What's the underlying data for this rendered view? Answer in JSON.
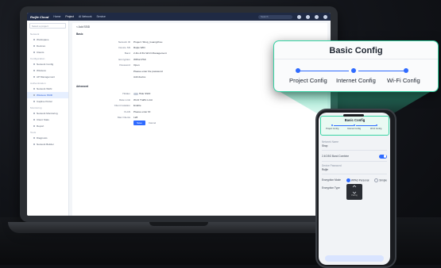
{
  "app": {
    "brand": "Ruijie Cloud",
    "nav": [
      "Home",
      "Project",
      "AI Network",
      "Service"
    ],
    "search_placeholder": "Search"
  },
  "sidebar": {
    "project_select": "Select a project",
    "groups": [
      {
        "label": "Network",
        "items": [
          "Workspace",
          "Devices",
          "Clients"
        ]
      },
      {
        "label": "Configuration",
        "items": [
          "Network Config",
          "Wireless",
          "AP Management"
        ]
      },
      {
        "label": "Authentication",
        "items": [
          "Network WAN",
          "Wireless SSID",
          "Captive Portal"
        ]
      },
      {
        "label": "Monitoring",
        "items": [
          "Network Monitoring",
          "Client Stats",
          "Report"
        ]
      },
      {
        "label": "Tools",
        "items": [
          "Diagnosis",
          "Network Builder"
        ]
      }
    ],
    "active_item": "Wireless SSID"
  },
  "main": {
    "breadcrumb": "< Add SSID",
    "section_basic": "Basic",
    "section_advanced": "Advanced",
    "fields": [
      {
        "label": "Network ID",
        "value": "Project: Shop_Guangzhou"
      },
      {
        "label": "Device SN",
        "value": "Ruijie WiFi"
      },
      {
        "label": "Band",
        "value": "2.4G & 5G     Wi-Fi Management"
      },
      {
        "label": "Encryption",
        "value": "WPA2-PSK"
      },
      {
        "label": "Password",
        "value": "Open"
      },
      {
        "label": "",
        "value": "Please enter the password"
      },
      {
        "label": "",
        "value": "Add device"
      }
    ],
    "advanced_fields": [
      {
        "label": "Hidden",
        "value": "Hide SSID"
      },
      {
        "label": "Rate Limit",
        "value": "Wi-Fi Traffic Limit"
      },
      {
        "label": "Client Isolation",
        "value": "Enable"
      },
      {
        "label": "VLAN",
        "value": "Please enter ID"
      },
      {
        "label": "Max Clients",
        "value": "128"
      }
    ],
    "save_label": "Save",
    "cancel_label": "Cancel"
  },
  "callout": {
    "title": "Basic Config",
    "steps": [
      "Project Config",
      "Internet Config",
      "Wi-Fi Config"
    ],
    "accent": "#37d3a4",
    "step_color": "#2f6bff"
  },
  "phone": {
    "title": "Basic Config",
    "steps": [
      "Project Config",
      "Internet Config",
      "Wi-Fi Config"
    ],
    "fields": [
      {
        "label": "Network Name",
        "value": "Shop"
      },
      {
        "label": "2.4G/5G Band Combine",
        "value": ""
      },
      {
        "label": "Device Password",
        "value": "Ruijie"
      },
      {
        "label": "Encryption Mode",
        "value": "WPA2-Personal"
      }
    ],
    "encryption_options": [
      "WPA2-Personal",
      "Simple"
    ],
    "encryption_type_label": "Encryption Type",
    "qr_label": "Pairing"
  }
}
